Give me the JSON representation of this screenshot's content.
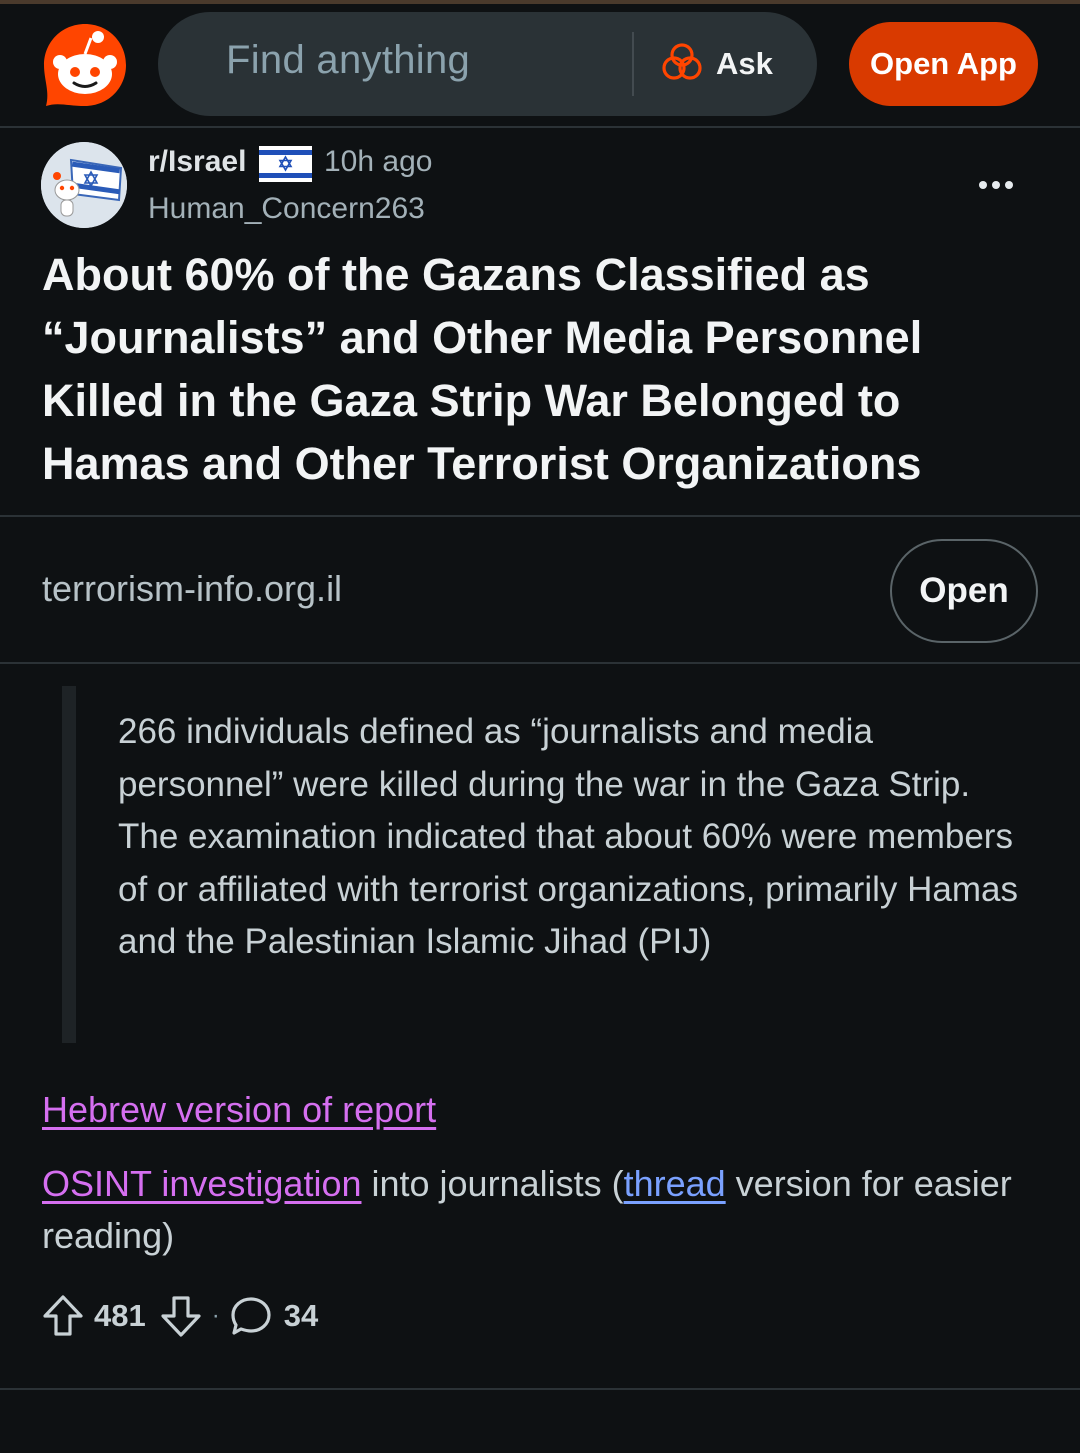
{
  "header": {
    "search_placeholder": "Find anything",
    "ask_label": "Ask",
    "open_app_label": "Open App"
  },
  "post": {
    "subreddit": "r/Israel",
    "age": "10h ago",
    "author": "Human_Concern263",
    "title": "About 60% of the Gazans Classified as “Journalists” and Other Media Personnel Killed in the Gaza Strip War Belonged to Hamas and Other Terrorist Organizations",
    "link_domain": "terrorism-info.org.il",
    "open_link_label": "Open",
    "quote": "266 individuals defined as “journalists and media personnel” were killed during the war in the Gaza Strip. The examination indicated that about 60% were members of or affiliated with terrorist organizations, primarily Hamas and the Palestinian Islamic Jihad (PIJ)",
    "link_hebrew": "Hebrew version of report",
    "link_osint": "OSINT investigation",
    "text_into": " into journalists (",
    "link_thread": "thread",
    "text_rest": " version for easier reading)",
    "upvotes": "481",
    "separator": "·",
    "comments": "34"
  },
  "icons": {
    "logo": "reddit-snoo-logo",
    "ask": "ask-answers-icon",
    "flag": "israel-flag-icon",
    "more": "more-options-icon",
    "upvote": "upvote-arrow-icon",
    "downvote": "downvote-arrow-icon",
    "comment": "comment-bubble-icon"
  },
  "colors": {
    "background": "#0e1113",
    "brand_orange": "#ff4500",
    "open_app_button": "#d93a00",
    "search_bg": "#2a3236",
    "visited_link": "#d56ff0",
    "link": "#7aa1ff"
  }
}
